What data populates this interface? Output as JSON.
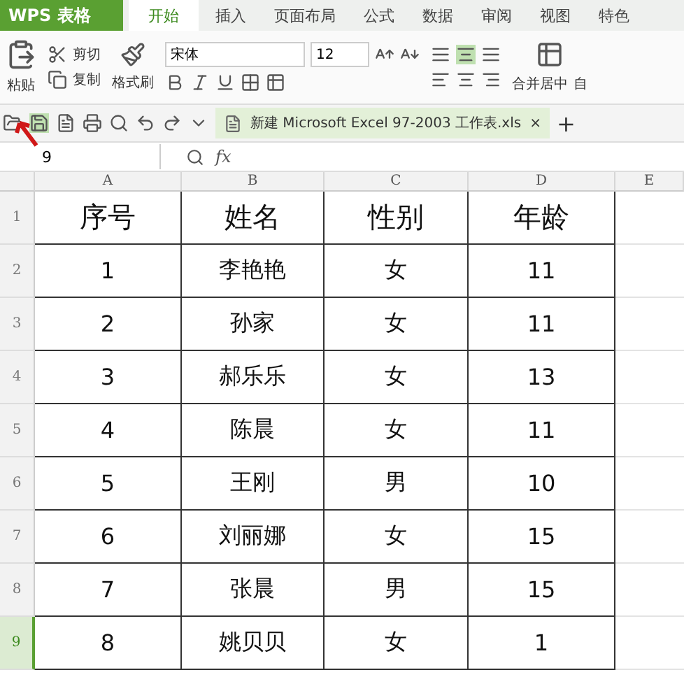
{
  "app_button": {
    "label": "WPS 表格"
  },
  "tabs": [
    {
      "label": "开始",
      "selected": true
    },
    {
      "label": "插入",
      "selected": false
    },
    {
      "label": "页面布局",
      "selected": false
    },
    {
      "label": "公式",
      "selected": false
    },
    {
      "label": "数据",
      "selected": false
    },
    {
      "label": "审阅",
      "selected": false
    },
    {
      "label": "视图",
      "selected": false
    },
    {
      "label": "特色",
      "selected": false
    }
  ],
  "ribbon": {
    "paste": "粘贴",
    "cut": "剪切",
    "copy": "复制",
    "format_painter": "格式刷",
    "font_name": "宋体",
    "font_size": "12",
    "merge": "合并居中",
    "cut_off": "自"
  },
  "document_tab": {
    "title": "新建 Microsoft Excel 97-2003 工作表.xls",
    "close": "×",
    "add": "+"
  },
  "name_box": {
    "value": "9"
  },
  "fx": "fx",
  "columns": [
    {
      "label": "A"
    },
    {
      "label": "B"
    },
    {
      "label": "C"
    },
    {
      "label": "D"
    },
    {
      "label": "E"
    }
  ],
  "rows": [
    {
      "header": "1",
      "selected": false,
      "cells": [
        "序号",
        "姓名",
        "性别",
        "年龄"
      ]
    },
    {
      "header": "2",
      "selected": false,
      "cells": [
        "1",
        "李艳艳",
        "女",
        "11"
      ]
    },
    {
      "header": "3",
      "selected": false,
      "cells": [
        "2",
        "孙家",
        "女",
        "11"
      ]
    },
    {
      "header": "4",
      "selected": false,
      "cells": [
        "3",
        "郝乐乐",
        "女",
        "13"
      ]
    },
    {
      "header": "5",
      "selected": false,
      "cells": [
        "4",
        "陈晨",
        "女",
        "11"
      ]
    },
    {
      "header": "6",
      "selected": false,
      "cells": [
        "5",
        "王刚",
        "男",
        "10"
      ]
    },
    {
      "header": "7",
      "selected": false,
      "cells": [
        "6",
        "刘丽娜",
        "女",
        "15"
      ]
    },
    {
      "header": "8",
      "selected": false,
      "cells": [
        "7",
        "张晨",
        "男",
        "15"
      ]
    },
    {
      "header": "9",
      "selected": true,
      "cells": [
        "8",
        "姚贝贝",
        "女",
        "1"
      ]
    }
  ]
}
